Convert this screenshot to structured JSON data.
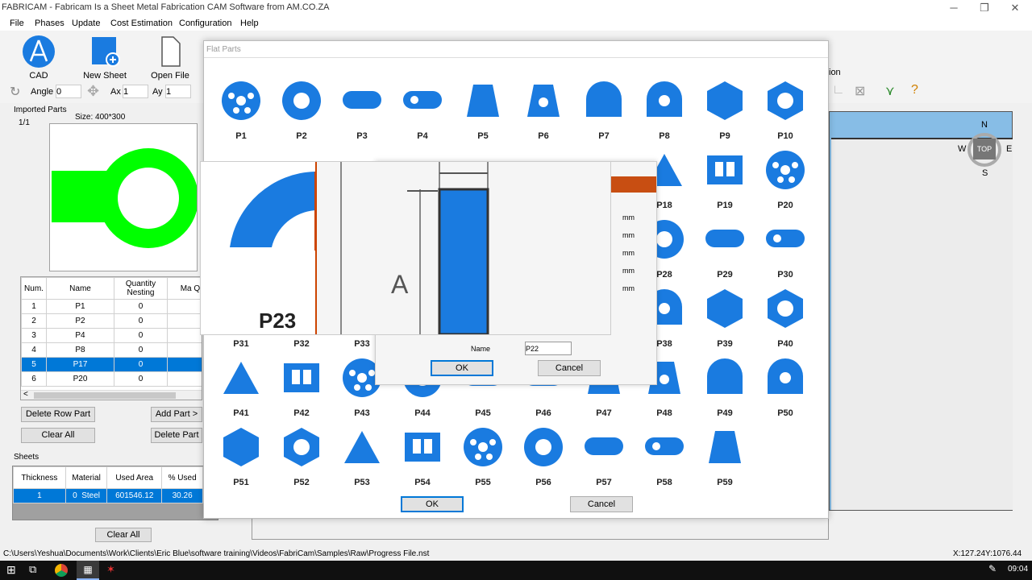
{
  "window": {
    "title": "FABRICAM - Fabricam Is a Sheet Metal Fabrication CAM Software from AM.CO.ZA"
  },
  "menu": [
    "File",
    "Phases",
    "Update",
    "Cost Estimation",
    "Configuration",
    "Help"
  ],
  "ribbon": {
    "cad": "CAD",
    "new_sheet": "New Sheet",
    "open_file": "Open File",
    "angle_label": "Angle",
    "angle_value": "0",
    "ax_label": "Ax",
    "ax_value": "1",
    "ay_label": "Ay",
    "ay_value": "1",
    "right_fragment": "ion"
  },
  "imported": {
    "title": "Imported Parts",
    "page": "1/1",
    "size": "Size: 400*300",
    "headers": [
      "Num.",
      "Name",
      "Quantity Nesting",
      "Ma Qua"
    ],
    "rows": [
      {
        "num": "1",
        "name": "P1",
        "qty": "0"
      },
      {
        "num": "2",
        "name": "P2",
        "qty": "0"
      },
      {
        "num": "3",
        "name": "P4",
        "qty": "0"
      },
      {
        "num": "4",
        "name": "P8",
        "qty": "0"
      },
      {
        "num": "5",
        "name": "P17",
        "qty": "0"
      },
      {
        "num": "6",
        "name": "P20",
        "qty": "0"
      }
    ],
    "delete_row": "Delete Row Part",
    "add_part": "Add Part >",
    "clear_all": "Clear All",
    "delete_part": "Delete Part"
  },
  "sheets": {
    "title": "Sheets",
    "headers": [
      "Thickness",
      "Material",
      "Used Area",
      "% Used"
    ],
    "row": {
      "thickness": "1",
      "material": "0",
      "material_name": "Steel",
      "used_area": "601546.12",
      "used": "30.26"
    },
    "clear_all": "Clear All"
  },
  "compass": {
    "n": "N",
    "s": "S",
    "w": "W",
    "e": "E",
    "top": "TOP"
  },
  "flat_parts": {
    "title": "Flat Parts",
    "labels": {
      "r0": [
        "P1",
        "P2",
        "P3",
        "P4",
        "P5",
        "P6",
        "P7",
        "P8",
        "P9",
        "P10"
      ],
      "r1": [
        "P18",
        "P19",
        "P20"
      ],
      "r2": [
        "P28",
        "P29",
        "P30"
      ],
      "r3": [
        "P31",
        "P32",
        "P33",
        "P38",
        "P39",
        "P40"
      ],
      "r4": [
        "P41",
        "P42",
        "P43",
        "P44",
        "P45",
        "P46",
        "P47",
        "P48",
        "P49",
        "P50"
      ],
      "r5": [
        "P51",
        "P52",
        "P53",
        "P54",
        "P55",
        "P56",
        "P57",
        "P58",
        "P59"
      ]
    },
    "ok": "OK",
    "cancel": "Cancel"
  },
  "inner_dialog": {
    "preview_label": "P23",
    "dim_label": "A",
    "units": [
      "mm",
      "mm",
      "mm",
      "mm",
      "mm"
    ],
    "name_label": "Name",
    "name_value": "P22",
    "ok": "OK",
    "cancel": "Cancel"
  },
  "status": {
    "path": "C:\\Users\\Yeshua\\Documents\\Work\\Clients\\Eric Blue\\software training\\Videos\\FabriCam\\Samples\\Raw\\Progress File.nst",
    "coords": "X:127.24Y:1076.44"
  },
  "taskbar": {
    "time": "09:04"
  },
  "colors": {
    "part_blue": "#1a7be0",
    "part_green": "#00ff00",
    "selected_row": "#0078d7"
  }
}
